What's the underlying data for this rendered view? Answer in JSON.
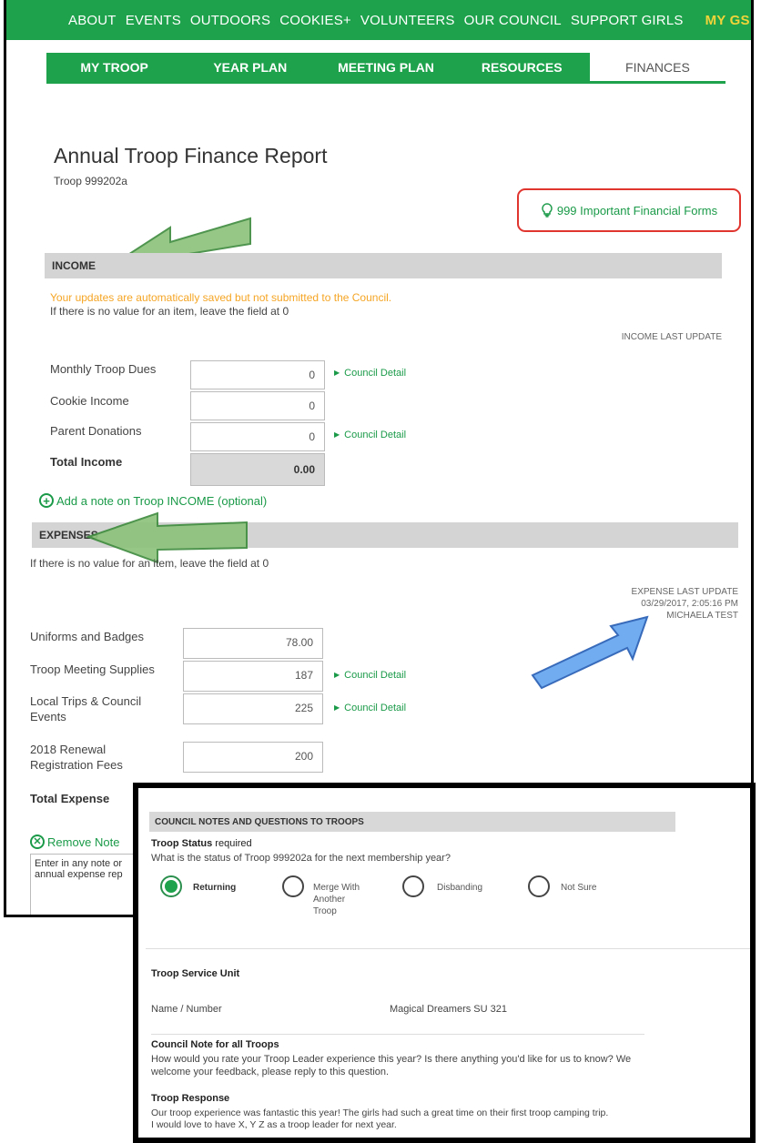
{
  "nav": {
    "items": [
      "ABOUT",
      "EVENTS",
      "OUTDOORS",
      "COOKIES+",
      "VOLUNTEERS",
      "OUR COUNCIL",
      "SUPPORT GIRLS"
    ],
    "my_gs": "MY GS"
  },
  "tabs": [
    "MY TROOP",
    "YEAR PLAN",
    "MEETING PLAN",
    "RESOURCES",
    "FINANCES"
  ],
  "active_tab": "FINANCES",
  "page": {
    "title": "Annual Troop Finance Report",
    "troop": "Troop 999202a",
    "forms_link": "999 Important Financial Forms"
  },
  "income": {
    "header": "INCOME",
    "autosave_notice": "Your updates are automatically saved but not submitted to the Council.",
    "hint": "If there is no value for an item, leave the field at 0",
    "last_update_label": "INCOME LAST UPDATE",
    "rows": [
      {
        "label": "Monthly Troop Dues",
        "value": "0",
        "detail": "Council Detail"
      },
      {
        "label": "Cookie Income",
        "value": "0"
      },
      {
        "label": "Parent Donations",
        "value": "0",
        "detail": "Council Detail"
      }
    ],
    "total_label": "Total Income",
    "total_value": "0.00",
    "add_note": "Add a note on Troop INCOME (optional)"
  },
  "expenses": {
    "header": "EXPENSES",
    "hint": "If there is no value for an item, leave the field at 0",
    "last_update_label": "EXPENSE LAST UPDATE",
    "last_update_time": "03/29/2017, 2:05:16 PM",
    "last_update_user": "MICHAELA TEST",
    "rows": [
      {
        "label": "Uniforms and Badges",
        "value": "78.00"
      },
      {
        "label": "Troop Meeting Supplies",
        "value": "187",
        "detail": "Council Detail"
      },
      {
        "label_line1": "Local Trips & Council",
        "label_line2": "Events",
        "value": "225",
        "detail": "Council Detail"
      },
      {
        "label_line1": "2018 Renewal",
        "label_line2": "Registration Fees",
        "value": "200"
      }
    ],
    "total_label": "Total Expense",
    "remove_note": "Remove Note",
    "note_line1": "Enter in any note or",
    "note_line2": "annual expense rep"
  },
  "council_notes": {
    "header": "COUNCIL NOTES AND QUESTIONS TO TROOPS",
    "status_title": "Troop Status",
    "status_required": "required",
    "status_question": "What is the status of Troop 999202a for the next membership year?",
    "options": [
      {
        "line1": "Returning",
        "selected": true
      },
      {
        "line1": "Merge With",
        "line2": "Another",
        "line3": "Troop"
      },
      {
        "line1": "Disbanding"
      },
      {
        "line1": "Not Sure"
      }
    ],
    "service_unit_title": "Troop Service Unit",
    "name_number_label": "Name / Number",
    "name_number_value": "Magical Dreamers SU 321",
    "council_note_title": "Council Note for all Troops",
    "council_note_line1": "How would you rate your Troop Leader experience this year? Is there anything you'd like for us to know? We",
    "council_note_line2": "welcome your feedback, please reply to this question.",
    "response_title": "Troop Response",
    "response_line1": "Our troop experience was fantastic this year! The girls had such a great time on their first troop camping trip.",
    "response_line2": "I would love to have X, Y Z as a troop leader for next year."
  },
  "colors": {
    "brand_green": "#1ea24b",
    "link_green": "#1a9a48",
    "notice_orange": "#f5a524",
    "highlight_red": "#e0342f",
    "my_gs_gold": "#f0d43a"
  }
}
